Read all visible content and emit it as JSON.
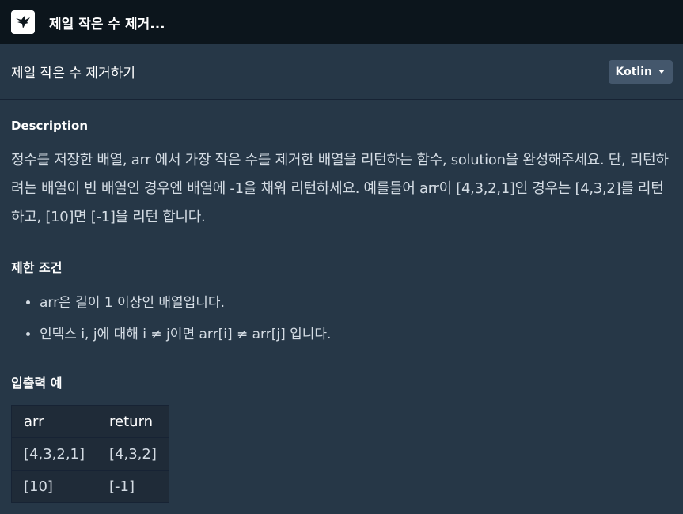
{
  "topbar": {
    "title": "제일 작은 수 제거..."
  },
  "header": {
    "title": "제일 작은 수 제거하기",
    "language": "Kotlin"
  },
  "description": {
    "heading": "Description",
    "text": "정수를 저장한 배열, arr 에서 가장 작은 수를 제거한 배열을 리턴하는 함수, solution을 완성해주세요. 단, 리턴하려는 배열이 빈 배열인 경우엔 배열에 -1을 채워 리턴하세요. 예를들어 arr이 [4,3,2,1]인 경우는 [4,3,2]를 리턴 하고, [10]면 [-1]을 리턴 합니다."
  },
  "constraints": {
    "heading": "제한 조건",
    "items": [
      "arr은 길이 1 이상인 배열입니다.",
      "인덱스 i, j에 대해 i ≠ j이면 arr[i] ≠ arr[j] 입니다."
    ]
  },
  "examples": {
    "heading": "입출력 예",
    "columns": [
      "arr",
      "return"
    ],
    "rows": [
      [
        "[4,3,2,1]",
        "[4,3,2]"
      ],
      [
        "[10]",
        "[-1]"
      ]
    ]
  },
  "colors": {
    "background": "#263747",
    "topbar": "#0c151c",
    "select": "#44576c",
    "table": "#1f2b38"
  }
}
